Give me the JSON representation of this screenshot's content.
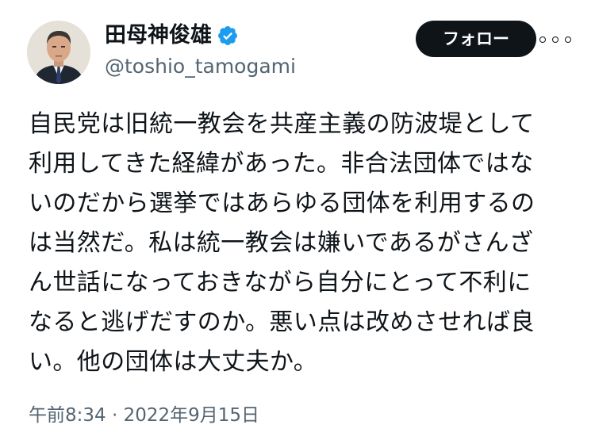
{
  "author": {
    "name": "田母神俊雄",
    "handle": "@toshio_tamogami",
    "verified": true
  },
  "actions": {
    "follow_label": "フォロー",
    "more_icon": "more-icon"
  },
  "tweet": {
    "lines": [
      "自民党は旧統一教会を共産主義の防波堤として",
      "利用してきた経緯があった。非合法団体ではな",
      "いのだから選挙ではあらゆる団体を利用するの",
      "は当然だ。私は統一教会は嫌いであるがさんざ",
      "ん世話になっておきながら自分にとって不利に",
      "なると逃げだすのか。悪い点は改めさせれば良",
      "い。他の団体は大丈夫か。"
    ],
    "timestamp": "午前8:34 · 2022年9月15日"
  },
  "colors": {
    "text": "#0f1419",
    "secondary": "#536471",
    "verified": "#1d9bf0",
    "follow_bg": "#0f1419"
  }
}
